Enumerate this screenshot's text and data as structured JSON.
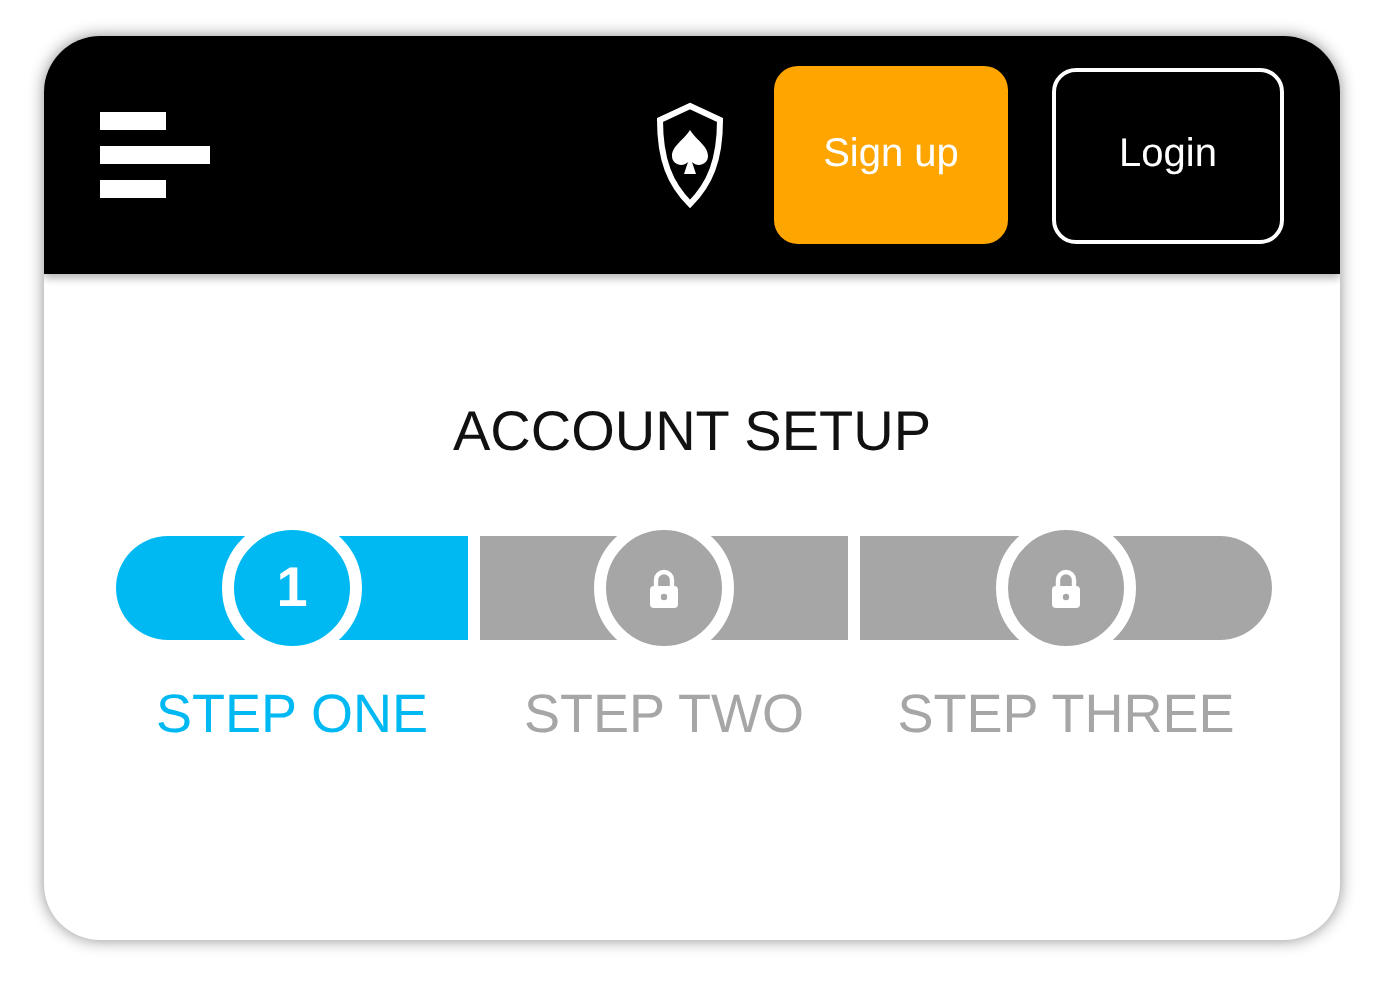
{
  "header": {
    "signup_button": "Sign up",
    "login_button": "Login"
  },
  "title": "ACCOUNT SETUP",
  "steps": [
    {
      "label": "STEP ONE",
      "selected": true,
      "kind": "number",
      "number": "1"
    },
    {
      "label": "STEP TWO",
      "selected": false,
      "kind": "locked"
    },
    {
      "label": "STEP THREE",
      "selected": false,
      "kind": "locked"
    }
  ]
}
